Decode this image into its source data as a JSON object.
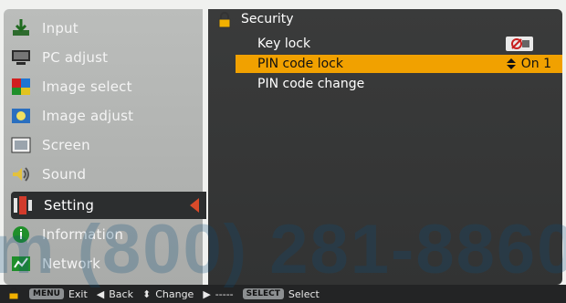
{
  "left_menu": {
    "items": [
      {
        "label": "Input",
        "icon": "input-icon"
      },
      {
        "label": "PC adjust",
        "icon": "pc-adjust-icon"
      },
      {
        "label": "Image select",
        "icon": "image-select-icon"
      },
      {
        "label": "Image adjust",
        "icon": "image-adjust-icon"
      },
      {
        "label": "Screen",
        "icon": "screen-icon"
      },
      {
        "label": "Sound",
        "icon": "sound-icon"
      },
      {
        "label": "Setting",
        "icon": "setting-icon",
        "active": true
      },
      {
        "label": "Information",
        "icon": "information-icon"
      },
      {
        "label": "Network",
        "icon": "network-icon"
      }
    ]
  },
  "security_panel": {
    "title": "Security",
    "rows": [
      {
        "label": "Key lock",
        "value": ""
      },
      {
        "label": "PIN code lock",
        "value": "On 1",
        "highlight": true
      },
      {
        "label": "PIN code change",
        "value": ""
      }
    ]
  },
  "bottom_bar": {
    "exit_button": "MENU",
    "exit": "Exit",
    "back": "Back",
    "change": "Change",
    "next": "-----",
    "select_button": "SELECT",
    "select": "Select"
  },
  "watermark": {
    "text": "m (800) 281-8860"
  },
  "colors": {
    "panel_bg": "#343535",
    "highlight": "#f1a100",
    "active_arrow": "#d84a2a",
    "left_menu_bg": "#b0b2b0"
  }
}
